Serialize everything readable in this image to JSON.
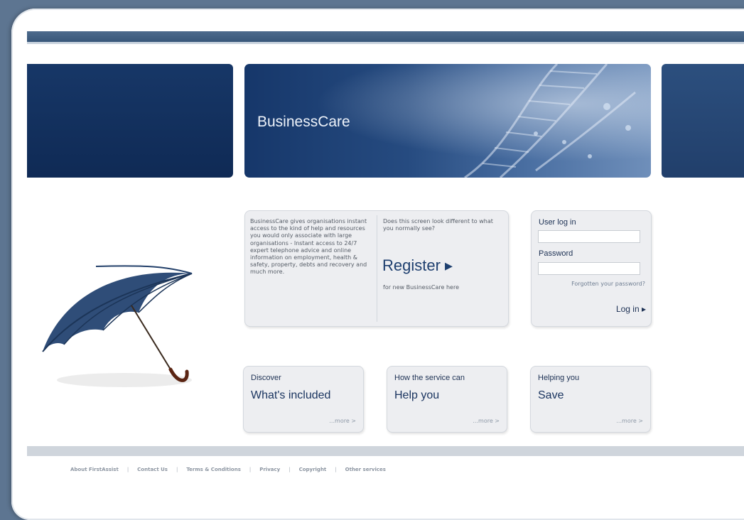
{
  "banner": {
    "title": "BusinessCare"
  },
  "intro": {
    "description": "BusinessCare gives organisations instant access to the kind of help and resources you would only associate with large organisations - Instant access to 24/7 expert telephone advice and online information on employment, health & safety, property, debts and recovery and much more.",
    "question": "Does this screen look different to what you normally see?",
    "register_label": "Register ▸",
    "register_sub": "for new BusinessCare here"
  },
  "login": {
    "user_label": "User log in",
    "password_label": "Password",
    "username_value": "",
    "password_value": "",
    "forgot_label": "Forgotten your password?",
    "login_button": "Log in ▸"
  },
  "features": [
    {
      "kicker": "Discover",
      "headline": "What's included",
      "more": "...more >"
    },
    {
      "kicker": "How the service can",
      "headline": "Help you",
      "more": "...more >"
    },
    {
      "kicker": "Helping you",
      "headline": "Save",
      "more": "...more >"
    }
  ],
  "footer": {
    "links": [
      "About FirstAssist",
      "Contact Us",
      "Terms & Conditions",
      "Privacy",
      "Copyright",
      "Other services"
    ],
    "separator": "|"
  },
  "colors": {
    "navy": "#173767",
    "outer_background": "#5d7591",
    "box_background": "#edeef1"
  },
  "icons": [
    "umbrella-image",
    "dna-helix-graphic",
    "play-arrow-icon"
  ]
}
